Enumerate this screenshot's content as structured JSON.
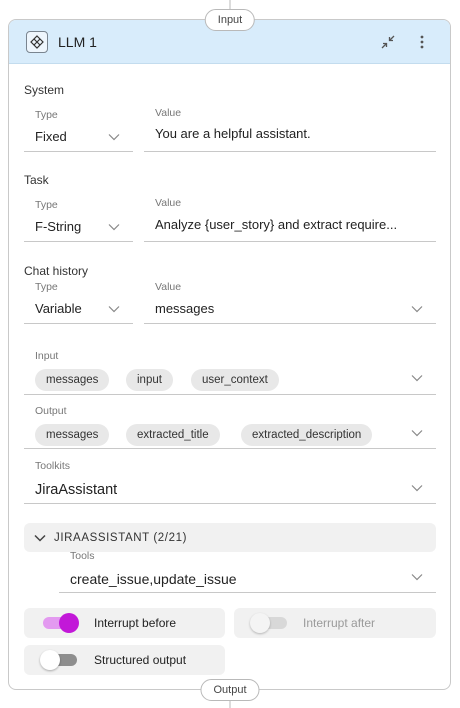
{
  "ports": {
    "input": "Input",
    "output": "Output"
  },
  "header": {
    "title": "LLM 1",
    "icon": "llm-node-icon",
    "collapse_icon": "collapse-arrows-icon",
    "menu_icon": "more-vertical-icon"
  },
  "system": {
    "label": "System",
    "type_label": "Type",
    "type_value": "Fixed",
    "value_label": "Value",
    "value": "You are a helpful assistant."
  },
  "task": {
    "label": "Task",
    "type_label": "Type",
    "type_value": "F-String",
    "value_label": "Value",
    "value": "Analyze {user_story} and extract require..."
  },
  "chat_history": {
    "label": "Chat history",
    "type_label": "Type",
    "type_value": "Variable",
    "value_label": "Value",
    "value": "messages"
  },
  "input": {
    "label": "Input",
    "chips": [
      "messages",
      "input",
      "user_context"
    ]
  },
  "output": {
    "label": "Output",
    "chips": [
      "messages",
      "extracted_title",
      "extracted_description"
    ]
  },
  "toolkits": {
    "label": "Toolkits",
    "value": "JiraAssistant"
  },
  "toolkit_group": {
    "title": "JIRAASSISTANT (2/21)",
    "tools_label": "Tools",
    "tools_value": "create_issue,update_issue"
  },
  "toggles": {
    "interrupt_before": {
      "label": "Interrupt before",
      "on": true
    },
    "interrupt_after": {
      "label": "Interrupt after",
      "on": false
    },
    "structured_output": {
      "label": "Structured output",
      "on": false
    }
  },
  "colors": {
    "header_bg": "#d8ecfb",
    "toggle_on": "#c218d8",
    "toggle_on_track": "#e39af0"
  }
}
